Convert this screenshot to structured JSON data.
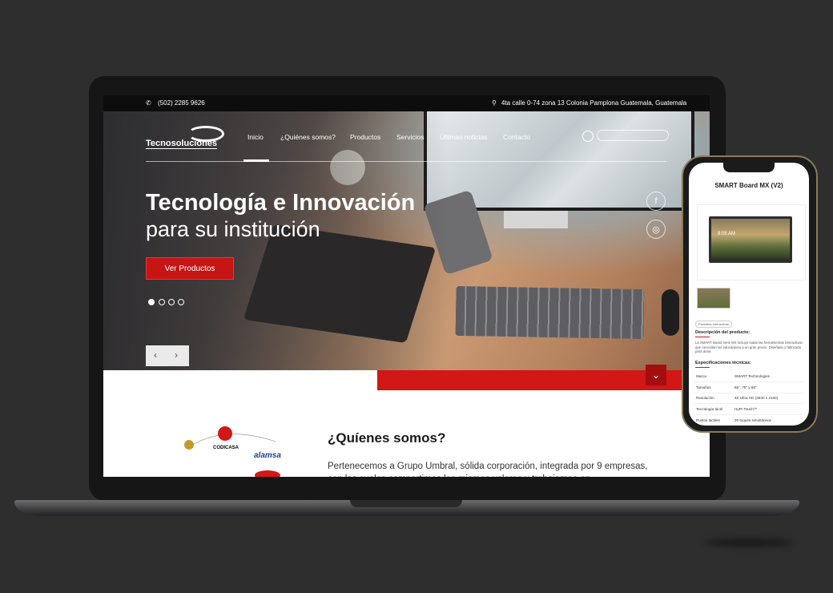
{
  "topbar": {
    "phone": "(502) 2285 9626",
    "address": "4ta calle 0-74 zona 13 Colonia Pamplona Guatemala, Guatemala"
  },
  "brand": {
    "name": "Tecnosoluciones"
  },
  "nav": {
    "items": [
      {
        "label": "Inicio"
      },
      {
        "label": "¿Quiénes somos?"
      },
      {
        "label": "Productos"
      },
      {
        "label": "Servicios"
      },
      {
        "label": "Últimas noticias"
      },
      {
        "label": "Contacto"
      }
    ],
    "search_placeholder": ""
  },
  "hero": {
    "title": "Tecnología e Innovación",
    "subtitle": "para su institución",
    "cta": "Ver Productos",
    "slides": 4,
    "active_slide": 1
  },
  "about": {
    "title": "¿Quíenes somos?",
    "text": "Pertenecemos a Grupo Umbral, sólida corporación, integrada por 9 empresas, con las cuales compartimos los mismos valores y trabajamos en"
  },
  "brands": {
    "codicasa": "CODICASA",
    "alamsa": "alamsa"
  },
  "phone_view": {
    "title": "SMART Board MX (V2)",
    "screen_time": "8:05 AM",
    "tag": "Pantallas Interactivas",
    "desc_title": "Descripción del producto:",
    "desc_text": "La SMART Board serie MX incluye todas las herramientas interactivas que necesitan los educadores a un gran precio. Diseñado y fabricado para durar.",
    "spec_title": "Especificaciones técnicas:",
    "specs": [
      {
        "k": "Marca",
        "v": "SMART Technologies"
      },
      {
        "k": "Tamaños",
        "v": "65\", 75\" y 86\""
      },
      {
        "k": "Resolución",
        "v": "4K Ultra HD (3840 x 2160)"
      },
      {
        "k": "Tecnología táctil",
        "v": "HyPr Touch™"
      },
      {
        "k": "Puntos táctiles",
        "v": "20 toques simultáneos"
      }
    ]
  },
  "colors": {
    "accent": "#d21717",
    "topbar": "#0d0d0d",
    "background": "#2e2e2e"
  }
}
